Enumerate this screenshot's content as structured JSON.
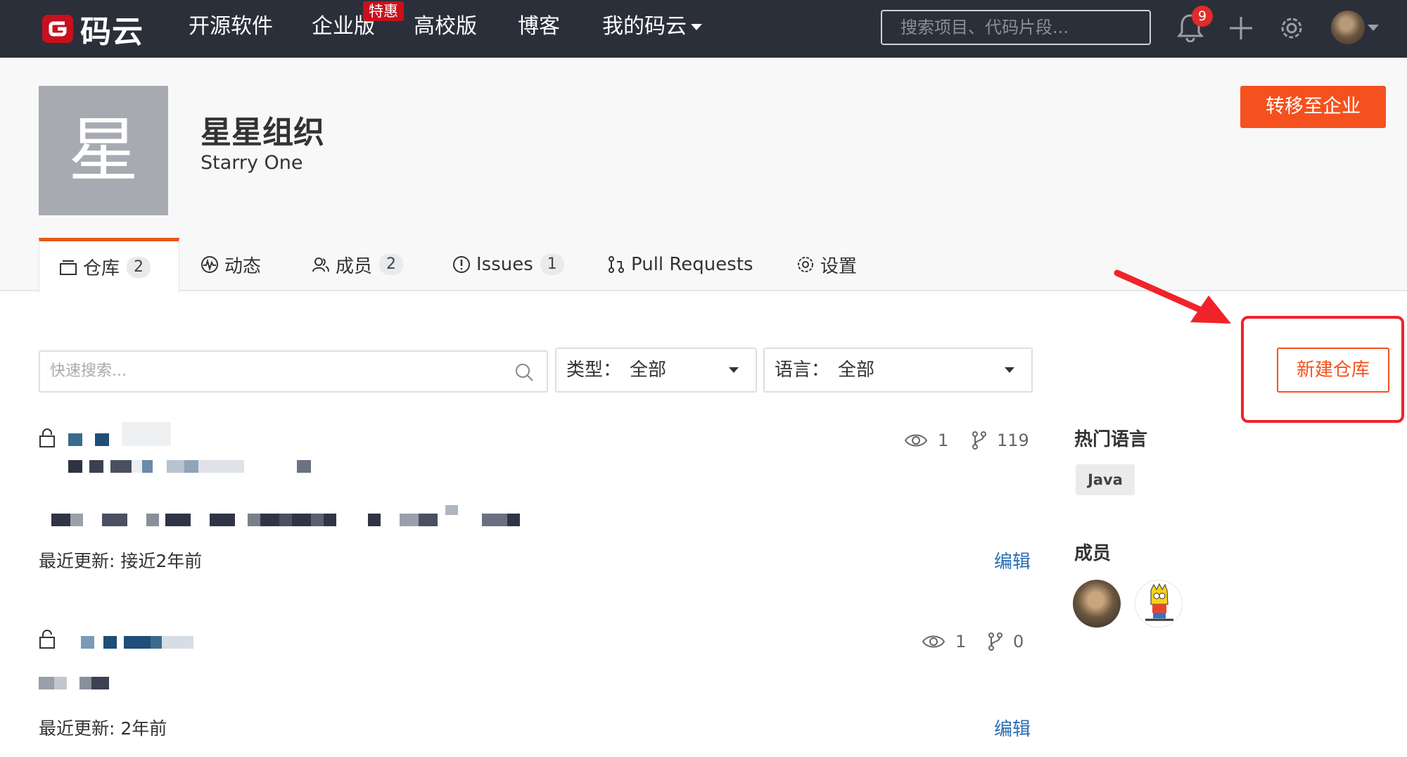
{
  "topnav": {
    "logo_text": "码云",
    "links": [
      "开源软件",
      "企业版",
      "高校版",
      "博客",
      "我的码云"
    ],
    "promo_badge": "特惠",
    "search_placeholder": "搜索项目、代码片段...",
    "notification_count": "9"
  },
  "org": {
    "avatar_char": "星",
    "name": "星星组织",
    "subtitle": "Starry One",
    "transfer_button": "转移至企业"
  },
  "tabs": [
    {
      "label": "仓库",
      "count": "2"
    },
    {
      "label": "动态"
    },
    {
      "label": "成员",
      "count": "2"
    },
    {
      "label": "Issues",
      "count": "1"
    },
    {
      "label": "Pull Requests"
    },
    {
      "label": "设置"
    }
  ],
  "filters": {
    "search_placeholder": "快速搜索...",
    "type_label": "类型：",
    "type_value": "全部",
    "language_label": "语言：",
    "language_value": "全部",
    "new_repo_button": "新建仓库"
  },
  "repos": [
    {
      "watchers": "1",
      "forks": "119",
      "updated": "最近更新: 接近2年前",
      "edit": "编辑"
    },
    {
      "watchers": "1",
      "forks": "0",
      "updated": "最近更新: 2年前",
      "edit": "编辑"
    }
  ],
  "sidebar": {
    "hot_languages_title": "热门语言",
    "languages": [
      "Java"
    ],
    "members_title": "成员"
  },
  "colors": {
    "nav_bg": "#2b2f3a",
    "accent_orange": "#f4511e",
    "link_blue": "#2a6eb5",
    "annotation_red": "#f0232a"
  }
}
